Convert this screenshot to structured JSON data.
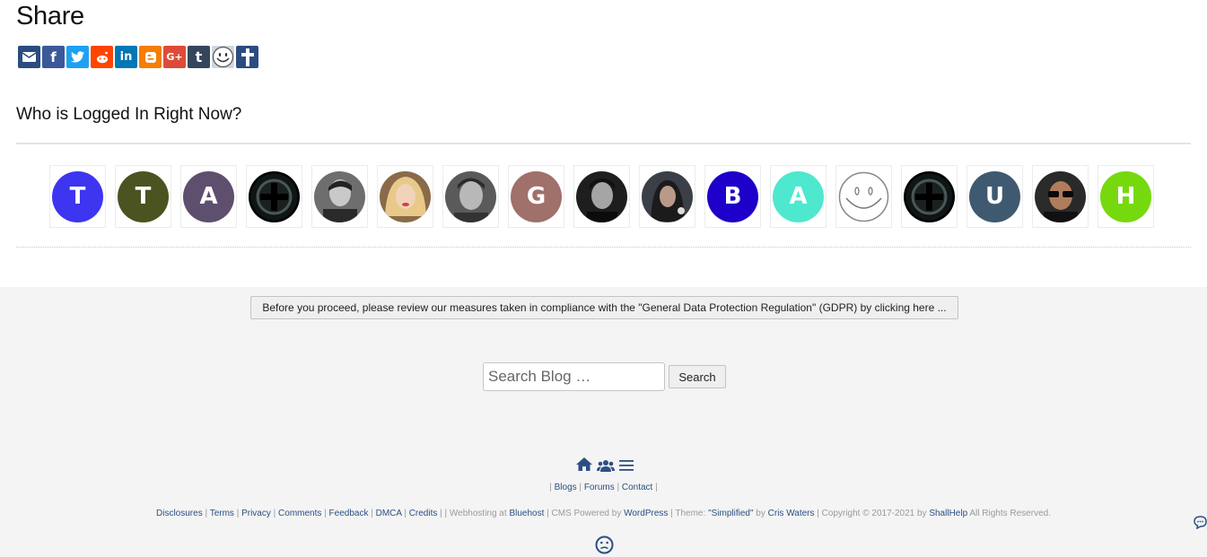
{
  "share": {
    "title": "Share",
    "buttons": [
      {
        "name": "email",
        "icon": "envelope-icon",
        "color": "#2b4c80"
      },
      {
        "name": "facebook",
        "icon": "facebook-icon",
        "color": "#3b5998",
        "glyph": "f"
      },
      {
        "name": "twitter",
        "icon": "twitter-icon",
        "color": "#1da1f2"
      },
      {
        "name": "reddit",
        "icon": "reddit-icon",
        "color": "#ff4500"
      },
      {
        "name": "linkedin",
        "icon": "linkedin-icon",
        "color": "#0077b5",
        "glyph": "in"
      },
      {
        "name": "blogger",
        "icon": "blogger-icon",
        "color": "#f57d00",
        "glyph": "B"
      },
      {
        "name": "google-plus",
        "icon": "google-plus-icon",
        "color": "#dd4b39",
        "glyph": "G+"
      },
      {
        "name": "tumblr",
        "icon": "tumblr-icon",
        "color": "#35465c",
        "glyph": "t"
      },
      {
        "name": "smiley",
        "icon": "smiley-icon",
        "color": "#cfd6df"
      },
      {
        "name": "cross",
        "icon": "cross-icon",
        "color": "#2b4c80"
      }
    ]
  },
  "logged_in": {
    "title": "Who is Logged In Right Now?",
    "avatars": [
      {
        "type": "letter",
        "letter": "T",
        "color": "#3d35f0"
      },
      {
        "type": "letter",
        "letter": "T",
        "color": "#4b5320"
      },
      {
        "type": "letter",
        "letter": "A",
        "color": "#5e4f6e"
      },
      {
        "type": "icon",
        "icon": "dark-cross-icon"
      },
      {
        "type": "photo",
        "icon": "user-photo-icon",
        "color": "#6e6e6e"
      },
      {
        "type": "photo",
        "icon": "user-photo-icon",
        "color": "#b5936a"
      },
      {
        "type": "photo",
        "icon": "user-photo-icon",
        "color": "#5a5a5a"
      },
      {
        "type": "letter",
        "letter": "G",
        "color": "#a0706a"
      },
      {
        "type": "photo",
        "icon": "user-photo-icon",
        "color": "#4a4a4a"
      },
      {
        "type": "photo",
        "icon": "user-photo-icon",
        "color": "#3a3f48"
      },
      {
        "type": "letter",
        "letter": "B",
        "color": "#1d00c9"
      },
      {
        "type": "letter",
        "letter": "A",
        "color": "#4ee8cf"
      },
      {
        "type": "icon",
        "icon": "smiley-avatar-icon"
      },
      {
        "type": "icon",
        "icon": "dark-cross-icon"
      },
      {
        "type": "letter",
        "letter": "U",
        "color": "#3f5a70"
      },
      {
        "type": "photo",
        "icon": "user-photo-icon",
        "color": "#2a2a2a"
      },
      {
        "type": "letter",
        "letter": "H",
        "color": "#76d90e"
      }
    ]
  },
  "footer": {
    "gdpr_label": "Before you proceed, please review our measures taken in compliance with the \"General Data Protection Regulation\" (GDPR) by clicking here ...",
    "search_placeholder": "Search Blog …",
    "search_button": "Search",
    "nav": {
      "blogs": "Blogs",
      "forums": "Forums",
      "contact": "Contact"
    },
    "credits": {
      "disclosures": "Disclosures",
      "terms": "Terms",
      "privacy": "Privacy",
      "comments": "Comments",
      "feedback": "Feedback",
      "dmca": "DMCA",
      "credits": "Credits",
      "webhosting_prefix": "Webhosting at",
      "bluehost": "Bluehost",
      "cms_prefix": "CMS Powered by",
      "wordpress": "WordPress",
      "theme_prefix": "Theme:",
      "theme": "\"Simplified\"",
      "by": "by",
      "author": "Cris Waters",
      "copyright_prefix": "Copyright © 2017-2021 by",
      "owner": "ShallHelp",
      "rights": "All Rights Reserved."
    }
  }
}
